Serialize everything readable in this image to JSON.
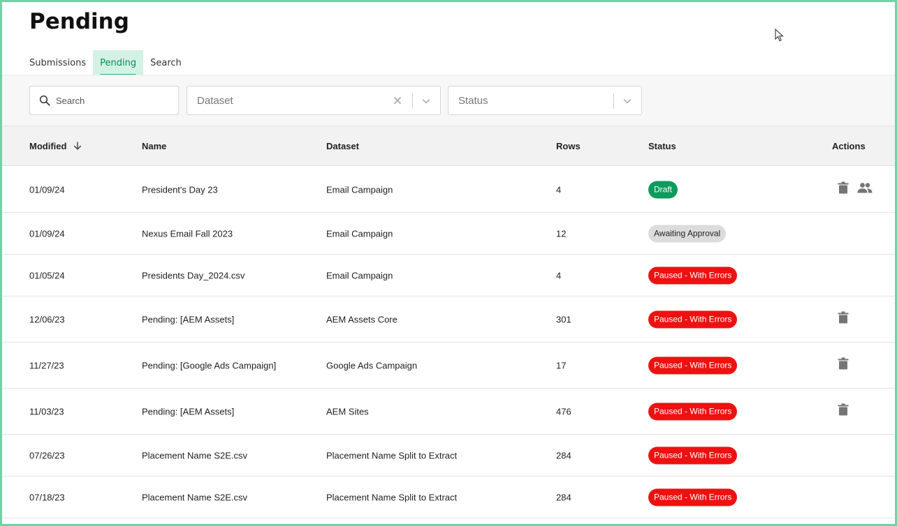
{
  "page": {
    "title": "Pending"
  },
  "tabs": [
    {
      "label": "Submissions",
      "active": false
    },
    {
      "label": "Pending",
      "active": true
    },
    {
      "label": "Search",
      "active": false
    }
  ],
  "filters": {
    "search_placeholder": "Search",
    "dataset_placeholder": "Dataset",
    "status_placeholder": "Status"
  },
  "table": {
    "columns": {
      "modified": "Modified",
      "name": "Name",
      "dataset": "Dataset",
      "rows": "Rows",
      "status": "Status",
      "actions": "Actions"
    },
    "rows": [
      {
        "modified": "01/09/24",
        "name": "President's Day 23",
        "dataset": "Email Campaign",
        "rows": "4",
        "status": "Draft",
        "status_type": "draft",
        "actions": [
          "trash-icon",
          "people-icon"
        ]
      },
      {
        "modified": "01/09/24",
        "name": "Nexus Email Fall 2023",
        "dataset": "Email Campaign",
        "rows": "12",
        "status": "Awaiting Approval",
        "status_type": "await",
        "actions": []
      },
      {
        "modified": "01/05/24",
        "name": "Presidents Day_2024.csv",
        "dataset": "Email Campaign",
        "rows": "4",
        "status": "Paused - With Errors",
        "status_type": "error",
        "actions": []
      },
      {
        "modified": "12/06/23",
        "name": "Pending: [AEM Assets]",
        "dataset": "AEM Assets Core",
        "rows": "301",
        "status": "Paused - With Errors",
        "status_type": "error",
        "actions": [
          "trash-icon"
        ]
      },
      {
        "modified": "11/27/23",
        "name": "Pending: [Google Ads Campaign]",
        "dataset": "Google Ads Campaign",
        "rows": "17",
        "status": "Paused - With Errors",
        "status_type": "error",
        "actions": [
          "trash-icon"
        ]
      },
      {
        "modified": "11/03/23",
        "name": "Pending: [AEM Assets]",
        "dataset": "AEM Sites",
        "rows": "476",
        "status": "Paused - With Errors",
        "status_type": "error",
        "actions": [
          "trash-icon"
        ]
      },
      {
        "modified": "07/26/23",
        "name": "Placement Name S2E.csv",
        "dataset": "Placement Name Split to Extract",
        "rows": "284",
        "status": "Paused - With Errors",
        "status_type": "error",
        "actions": []
      },
      {
        "modified": "07/18/23",
        "name": "Placement Name S2E.csv",
        "dataset": "Placement Name Split to Extract",
        "rows": "284",
        "status": "Paused - With Errors",
        "status_type": "error",
        "actions": []
      }
    ]
  },
  "colors": {
    "accent": "#22b67a",
    "tab_active_bg": "#d3f2e3",
    "draft": "#0f9a5e",
    "error": "#ee1111",
    "await": "#dcdcdc",
    "frame": "#6fd3a6"
  }
}
